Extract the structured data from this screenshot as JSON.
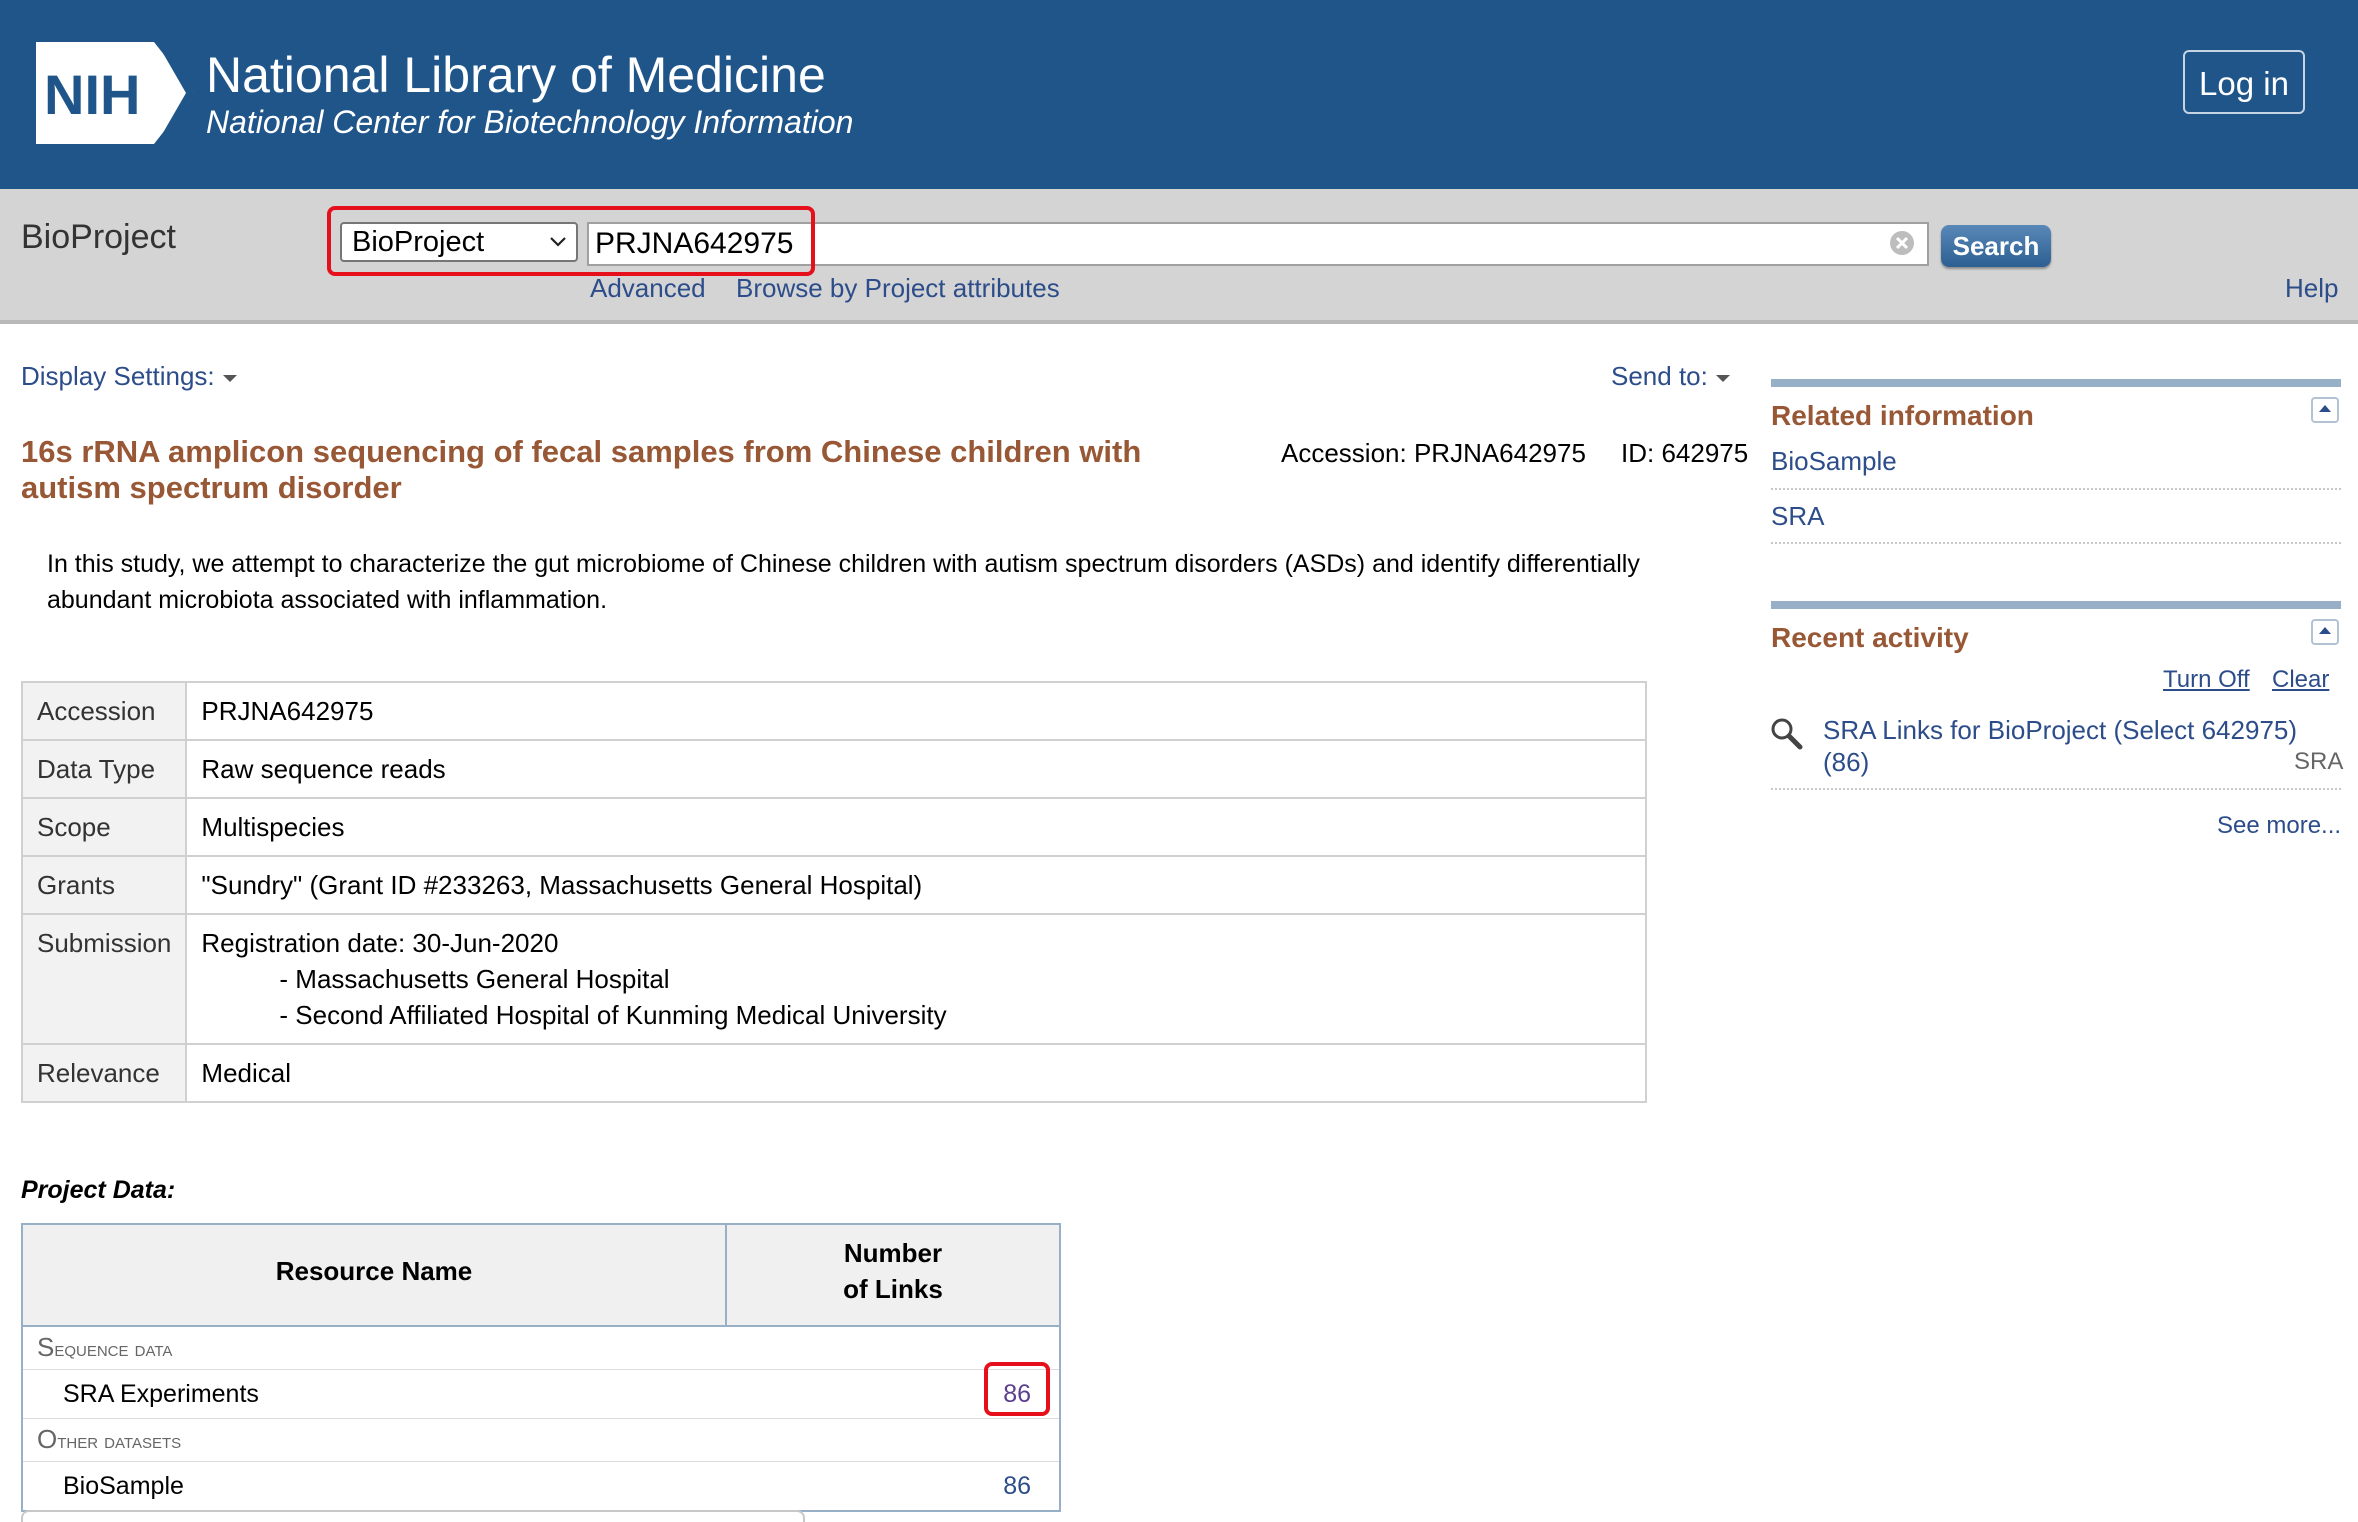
{
  "header": {
    "logo_text": "NIH",
    "title": "National Library of Medicine",
    "subtitle": "National Center for Biotechnology Information",
    "login_label": "Log in"
  },
  "search": {
    "database_name": "BioProject",
    "selected_db": "BioProject",
    "query": "PRJNA642975",
    "search_label": "Search",
    "advanced_label": "Advanced",
    "browse_label": "Browse by Project attributes",
    "help_label": "Help"
  },
  "toolbar": {
    "display_settings": "Display Settings:",
    "send_to": "Send to:"
  },
  "record": {
    "title": "16s rRNA amplicon sequencing of fecal samples from Chinese children with autism spectrum disorder",
    "accession_line": "Accession: PRJNA642975",
    "id_line": "ID: 642975",
    "description": "In this study, we attempt to characterize the gut microbiome of Chinese children with autism spectrum disorders (ASDs) and identify differentially abundant microbiota associated with inflammation.",
    "fields": {
      "accession_label": "Accession",
      "accession_value": "PRJNA642975",
      "data_type_label": "Data Type",
      "data_type_value": "Raw sequence reads",
      "scope_label": "Scope",
      "scope_value": "Multispecies",
      "grants_label": "Grants",
      "grants_value": "\"Sundry\" (Grant ID #233263, Massachusetts General Hospital)",
      "submission_label": "Submission",
      "registration_date": "Registration date: 30-Jun-2020",
      "submitter_1": "- Massachusetts General Hospital",
      "submitter_2": "- Second Affiliated Hospital of Kunming Medical University",
      "relevance_label": "Relevance",
      "relevance_value": "Medical"
    }
  },
  "project_data": {
    "label": "Project Data:",
    "col_resource": "Resource Name",
    "col_links_line1": "Number",
    "col_links_line2": "of Links",
    "category_1_initial": "S",
    "category_1_rest": "equence data",
    "resource_1_name": "SRA Experiments",
    "resource_1_count": "86",
    "category_2_initial": "O",
    "category_2_rest": "ther datasets",
    "resource_2_name": "BioSample",
    "resource_2_count": "86"
  },
  "sidebar": {
    "related_title": "Related information",
    "related_1": "BioSample",
    "related_2": "SRA",
    "recent_title": "Recent activity",
    "turn_off": "Turn Off",
    "clear": "Clear",
    "activity_text": "SRA Links for BioProject (Select 642975) (86)",
    "activity_db": "SRA",
    "see_more": "See more..."
  },
  "colors": {
    "header_bg": "#20558a",
    "link": "#2c4d8a",
    "title_brown": "#985735",
    "highlight_red": "#e5101c"
  }
}
